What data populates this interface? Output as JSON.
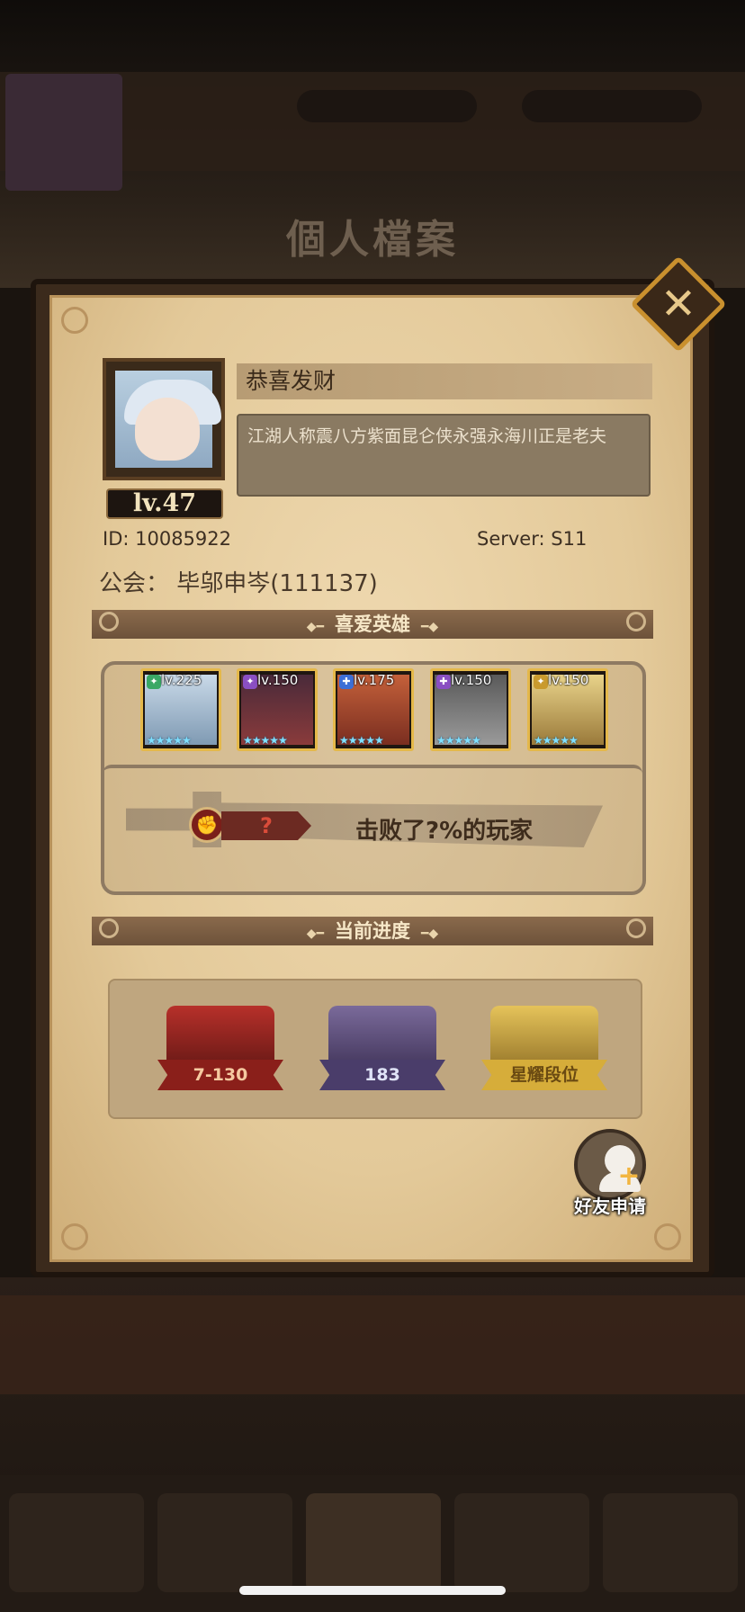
{
  "background": {
    "title": "個人檔案"
  },
  "profile": {
    "name": "恭喜发财",
    "level": "lv.47",
    "motto": "江湖人称震八方紫面昆仑侠永强永海川正是老夫",
    "id_text": "ID:  10085922",
    "server_text": "Server: S11",
    "guild_text": "公会：  毕邬申岑(111137)"
  },
  "favorite_heroes": {
    "title": "喜爱英雄",
    "heroes": [
      {
        "level": "lv.225",
        "class_icon": "green-class-icon",
        "stars": "★★★★★",
        "color": "#3aa865"
      },
      {
        "level": "lv.150",
        "class_icon": "purple-class-icon",
        "stars": "★★★★★",
        "color": "#8a4fc2"
      },
      {
        "level": "lv.175",
        "class_icon": "blue-class-icon",
        "stars": "★★★★★",
        "color": "#3d6fd6"
      },
      {
        "level": "lv.150",
        "class_icon": "purple-class-icon",
        "stars": "★★★★★",
        "color": "#8a4fc2"
      },
      {
        "level": "lv.150",
        "class_icon": "gold-class-icon",
        "stars": "★★★★★",
        "color": "#c99a2e"
      }
    ]
  },
  "defeat": {
    "value": "?",
    "text": "击败了?%的玩家"
  },
  "progress": {
    "title": "当前进度",
    "items": [
      {
        "label": "7-130",
        "icon": "campaign-book-icon"
      },
      {
        "label": "183",
        "icon": "tower-icon"
      },
      {
        "label": "星耀段位",
        "icon": "crossed-swords-rank-icon"
      }
    ]
  },
  "friend_request": {
    "label": "好友申请"
  },
  "colors": {
    "panel": "#e6cc9c",
    "banner": "#7a5c42",
    "frame_gold": "#e4b84a"
  }
}
